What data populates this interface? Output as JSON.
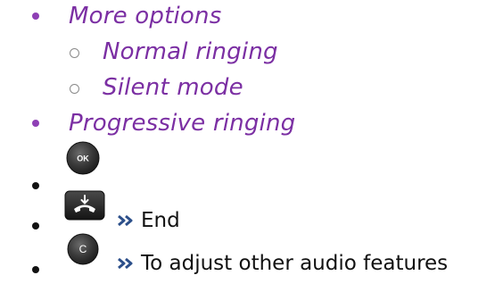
{
  "colors": {
    "option_text": "#7b2fa3",
    "bullet_purple": "#8e3fb5",
    "bullet_black": "#111111",
    "arrow": "#2c4f8a"
  },
  "items": [
    {
      "label": "More options"
    },
    {
      "label": "Normal ringing"
    },
    {
      "label": "Silent mode"
    },
    {
      "label": "Progressive ringing"
    }
  ],
  "keys": {
    "ok": {
      "icon": "ok-key-icon",
      "label": "OK"
    },
    "hangup": {
      "icon": "hang-up-key-icon"
    },
    "clear": {
      "icon": "c-key-icon",
      "label": "C"
    }
  },
  "steps": {
    "end": {
      "arrow_icon": "double-chevron-right-icon",
      "text": "End"
    },
    "adjust": {
      "arrow_icon": "double-chevron-right-icon",
      "text": "To adjust other audio features"
    }
  }
}
